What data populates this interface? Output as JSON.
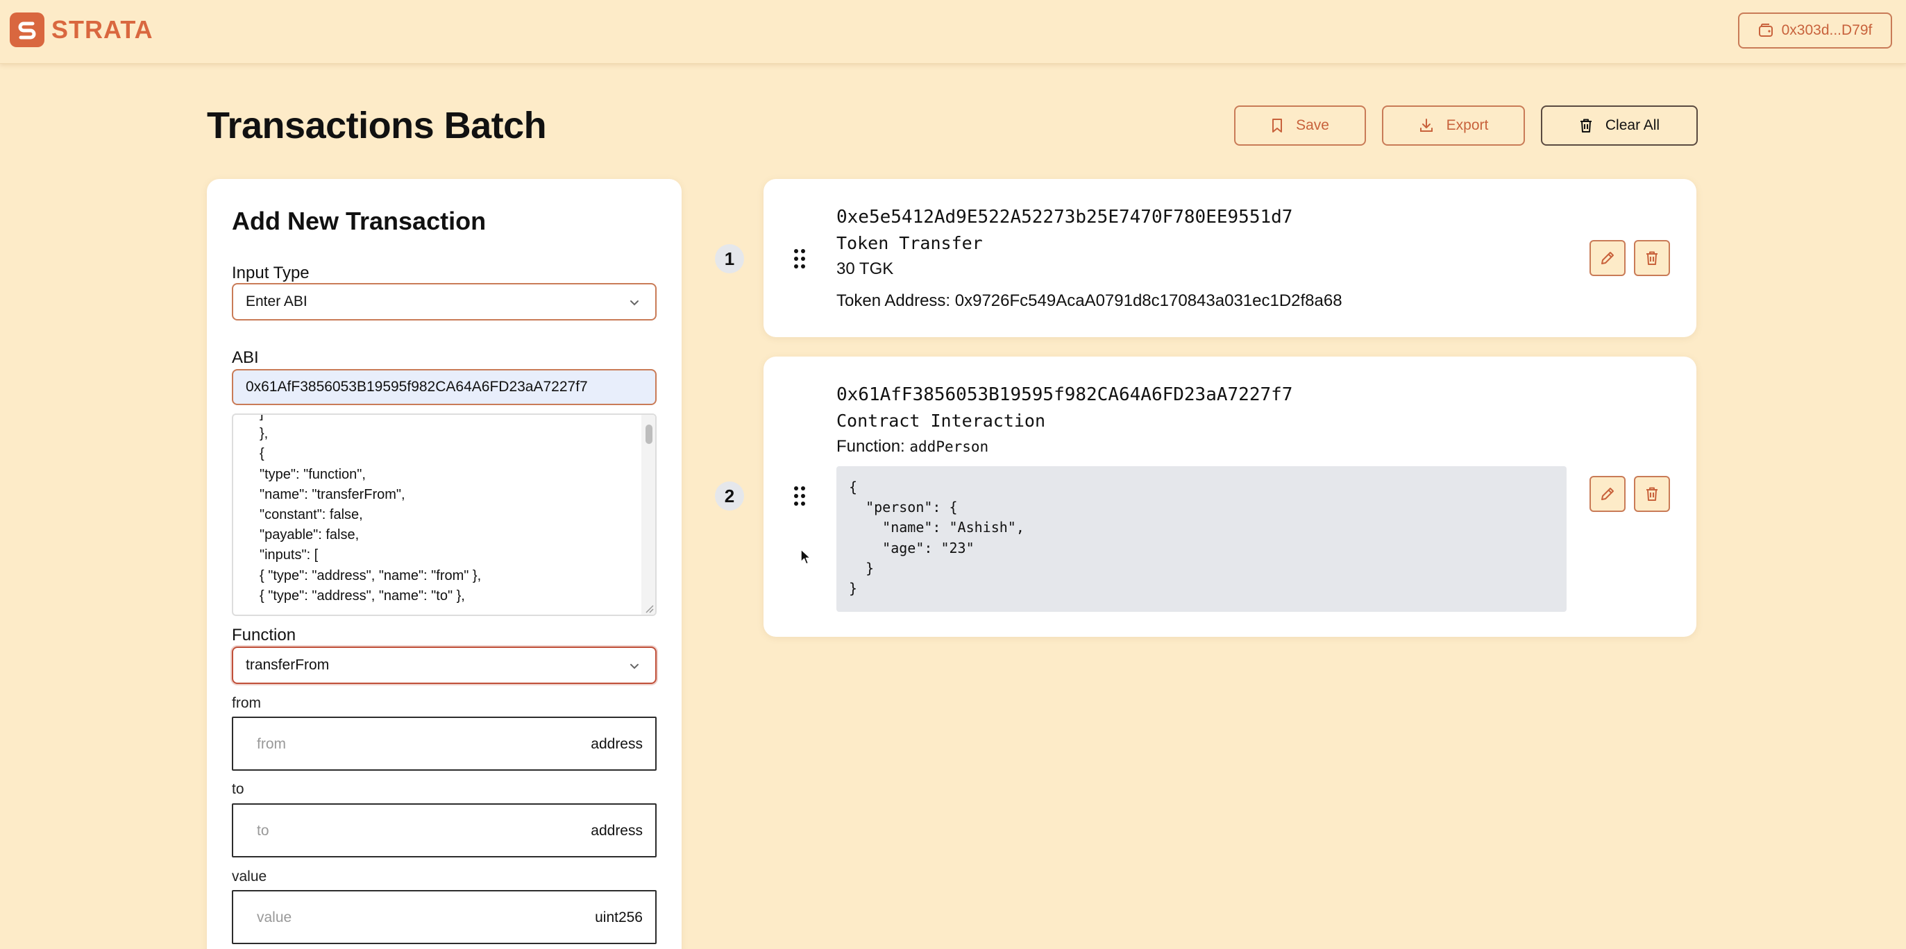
{
  "header": {
    "logo_text": "STRATA",
    "wallet_label": "0x303d...D79f"
  },
  "page": {
    "title": "Transactions Batch",
    "save_label": "Save",
    "export_label": "Export",
    "clear_label": "Clear All"
  },
  "form": {
    "title": "Add New Transaction",
    "input_type_label": "Input Type",
    "input_type_value": "Enter ABI",
    "abi_label": "ABI",
    "abi_address": "0x61AfF3856053B19595f982CA64A6FD23aA7227f7",
    "abi_text": "]\n},\n{\n\"type\": \"function\",\n\"name\": \"transferFrom\",\n\"constant\": false,\n\"payable\": false,\n\"inputs\": [\n{ \"type\": \"address\", \"name\": \"from\" },\n{ \"type\": \"address\", \"name\": \"to\" },",
    "function_label": "Function",
    "function_value": "transferFrom",
    "params": [
      {
        "label": "from",
        "placeholder": "from",
        "type": "address"
      },
      {
        "label": "to",
        "placeholder": "to",
        "type": "address"
      },
      {
        "label": "value",
        "placeholder": "value",
        "type": "uint256"
      }
    ]
  },
  "transactions": [
    {
      "index": "1",
      "address": "0xe5e5412Ad9E522A52273b25E7470F780EE9551d7",
      "kind": "Token Transfer",
      "amount": "30 TGK",
      "token_address_text": "Token Address: 0x9726Fc549AcaA0791d8c170843a031ec1D2f8a68"
    },
    {
      "index": "2",
      "address": "0x61AfF3856053B19595f982CA64A6FD23aA7227f7",
      "kind": "Contract Interaction",
      "function_label": "Function:",
      "function_name": "addPerson",
      "code": "{\n  \"person\": {\n    \"name\": \"Ashish\",\n    \"age\": \"23\"\n  }\n}"
    }
  ],
  "colors": {
    "background": "#fdebc8",
    "accent": "#d9673f",
    "card": "#ffffff",
    "code_bg": "#e5e7eb"
  }
}
